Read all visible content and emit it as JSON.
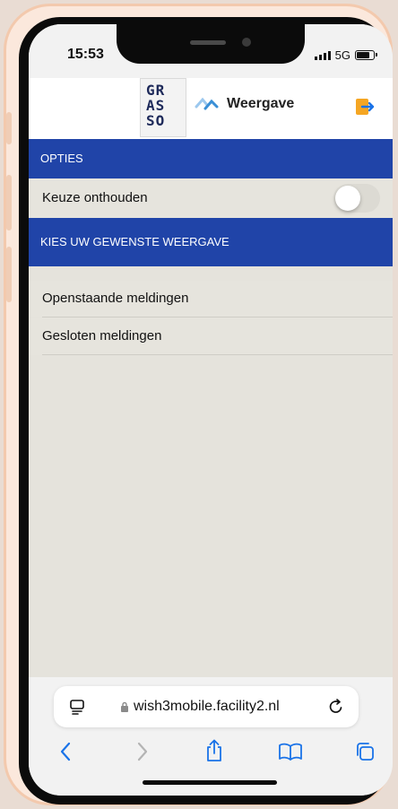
{
  "status": {
    "time": "15:53",
    "network": "5G"
  },
  "header": {
    "logo_lines": [
      "GR",
      "AS",
      "SO"
    ],
    "title": "Weergave"
  },
  "options": {
    "header": "OPTIES",
    "remember_label": "Keuze onthouden",
    "remember_on": false
  },
  "views": {
    "header": "KIES UW GEWENSTE WEERGAVE",
    "items": [
      {
        "label": "Openstaande meldingen"
      },
      {
        "label": "Gesloten meldingen"
      }
    ]
  },
  "browser": {
    "url": "wish3mobile.facility2.nl"
  },
  "colors": {
    "accent": "#2044a8",
    "exit_icon": "#f5a623",
    "link": "#1a73e8"
  },
  "icons": {
    "exit": "exit-icon",
    "reload": "reload-icon",
    "tabs": "tabs-icon",
    "back": "chevron-left-icon",
    "forward": "chevron-right-icon",
    "share": "share-icon",
    "bookmarks": "book-icon",
    "pages": "tabs-overview-icon"
  }
}
